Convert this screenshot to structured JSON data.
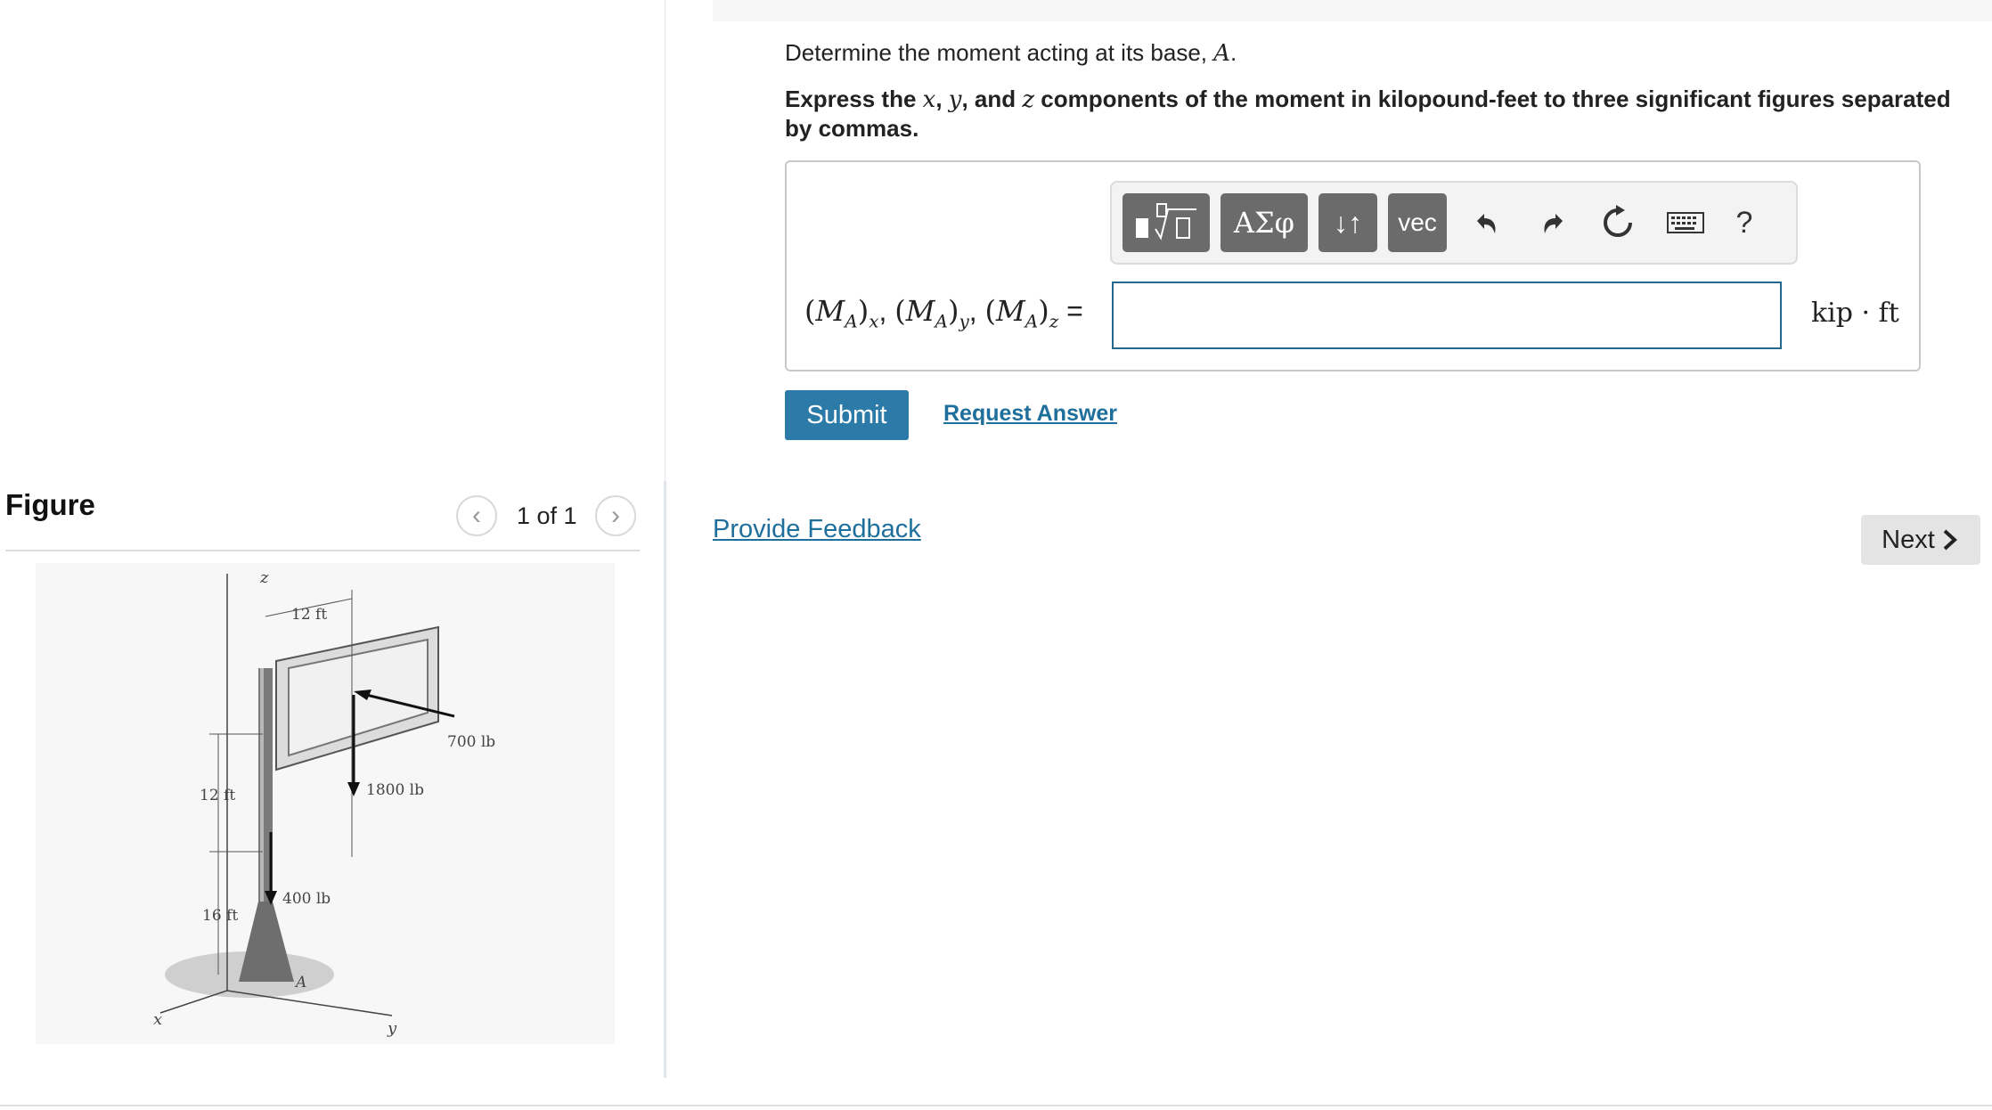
{
  "question": {
    "line1_prefix": "Determine the moment acting at its base, ",
    "line1_var": "A",
    "line1_suffix": ".",
    "instr_1": "Express the ",
    "instr_x": "x",
    "instr_2": ", ",
    "instr_y": "y",
    "instr_3": ", and ",
    "instr_z": "z",
    "instr_4": " components of the moment in kilopound-feet to three significant figures separated by commas."
  },
  "toolbar": {
    "templates_icon": "templates-icon",
    "greek_label": "ΑΣφ",
    "updown_label": "↓↑",
    "vec_label": "vec",
    "undo_icon": "undo-icon",
    "redo_icon": "redo-icon",
    "reset_icon": "reset-icon",
    "keyboard_icon": "keyboard-icon",
    "help_label": "?"
  },
  "answer": {
    "label": "(MA)x , (MA)y , (MA)z =",
    "input_value": "",
    "units": "kip · ft"
  },
  "actions": {
    "submit_label": "Submit",
    "request_label": "Request Answer",
    "feedback_label": "Provide Feedback",
    "next_label": "Next"
  },
  "figure": {
    "title": "Figure",
    "pager": "1 of 1",
    "labels": {
      "z": "z",
      "x": "x",
      "y": "y",
      "a": "A",
      "dim_12_top": "12 ft",
      "dim_12_side": "12 ft",
      "dim_16": "16 ft",
      "f700": "700 lb",
      "f1800": "1800 lb",
      "f400": "400 lb"
    }
  },
  "colors": {
    "accent": "#2b7aa7",
    "link": "#1f6f9c",
    "toolbar_button": "#6b6b6b"
  }
}
